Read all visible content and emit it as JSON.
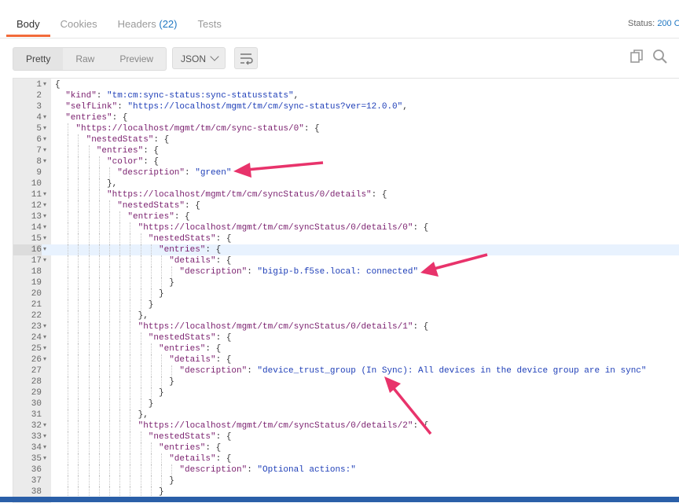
{
  "tabs": {
    "body": "Body",
    "cookies": "Cookies",
    "headers": "Headers",
    "headers_count": "(22)",
    "tests": "Tests"
  },
  "status": {
    "label": "Status:",
    "value": "200 O"
  },
  "toolbar": {
    "pretty": "Pretty",
    "raw": "Raw",
    "preview": "Preview",
    "format": "JSON",
    "icons": [
      "wrap-lines-icon",
      "copy-icon",
      "search-icon"
    ]
  },
  "editor": {
    "highlighted_line": 16,
    "lines": [
      {
        "n": "1",
        "i": 0,
        "f": true,
        "t": [
          [
            "p",
            "{"
          ]
        ]
      },
      {
        "n": "2",
        "i": 1,
        "f": false,
        "t": [
          [
            "k",
            "\"kind\""
          ],
          [
            "p",
            ": "
          ],
          [
            "s",
            "\"tm:cm:sync-status:sync-statusstats\""
          ],
          [
            "p",
            ","
          ]
        ]
      },
      {
        "n": "3",
        "i": 1,
        "f": false,
        "t": [
          [
            "k",
            "\"selfLink\""
          ],
          [
            "p",
            ": "
          ],
          [
            "s",
            "\"https://localhost/mgmt/tm/cm/sync-status?ver=12.0.0\""
          ],
          [
            "p",
            ","
          ]
        ]
      },
      {
        "n": "4",
        "i": 1,
        "f": true,
        "t": [
          [
            "k",
            "\"entries\""
          ],
          [
            "p",
            ": {"
          ]
        ]
      },
      {
        "n": "5",
        "i": 2,
        "f": true,
        "t": [
          [
            "k",
            "\"https://localhost/mgmt/tm/cm/sync-status/0\""
          ],
          [
            "p",
            ": {"
          ]
        ]
      },
      {
        "n": "6",
        "i": 3,
        "f": true,
        "t": [
          [
            "k",
            "\"nestedStats\""
          ],
          [
            "p",
            ": {"
          ]
        ]
      },
      {
        "n": "7",
        "i": 4,
        "f": true,
        "t": [
          [
            "k",
            "\"entries\""
          ],
          [
            "p",
            ": {"
          ]
        ]
      },
      {
        "n": "8",
        "i": 5,
        "f": true,
        "t": [
          [
            "k",
            "\"color\""
          ],
          [
            "p",
            ": {"
          ]
        ]
      },
      {
        "n": "9",
        "i": 6,
        "f": false,
        "t": [
          [
            "k",
            "\"description\""
          ],
          [
            "p",
            ": "
          ],
          [
            "s",
            "\"green\""
          ]
        ]
      },
      {
        "n": "10",
        "i": 5,
        "f": false,
        "t": [
          [
            "p",
            "},"
          ]
        ]
      },
      {
        "n": "11",
        "i": 5,
        "f": true,
        "t": [
          [
            "k",
            "\"https://localhost/mgmt/tm/cm/syncStatus/0/details\""
          ],
          [
            "p",
            ": {"
          ]
        ]
      },
      {
        "n": "12",
        "i": 6,
        "f": true,
        "t": [
          [
            "k",
            "\"nestedStats\""
          ],
          [
            "p",
            ": {"
          ]
        ]
      },
      {
        "n": "13",
        "i": 7,
        "f": true,
        "t": [
          [
            "k",
            "\"entries\""
          ],
          [
            "p",
            ": {"
          ]
        ]
      },
      {
        "n": "14",
        "i": 8,
        "f": true,
        "t": [
          [
            "k",
            "\"https://localhost/mgmt/tm/cm/syncStatus/0/details/0\""
          ],
          [
            "p",
            ": {"
          ]
        ]
      },
      {
        "n": "15",
        "i": 9,
        "f": true,
        "t": [
          [
            "k",
            "\"nestedStats\""
          ],
          [
            "p",
            ": {"
          ]
        ]
      },
      {
        "n": "16",
        "i": 10,
        "f": true,
        "t": [
          [
            "k",
            "\"entries\""
          ],
          [
            "p",
            ": {"
          ]
        ]
      },
      {
        "n": "17",
        "i": 11,
        "f": true,
        "t": [
          [
            "k",
            "\"details\""
          ],
          [
            "p",
            ": {"
          ]
        ]
      },
      {
        "n": "18",
        "i": 12,
        "f": false,
        "t": [
          [
            "k",
            "\"description\""
          ],
          [
            "p",
            ": "
          ],
          [
            "s",
            "\"bigip-b.f5se.local: connected\""
          ]
        ]
      },
      {
        "n": "19",
        "i": 11,
        "f": false,
        "t": [
          [
            "p",
            "}"
          ]
        ]
      },
      {
        "n": "20",
        "i": 10,
        "f": false,
        "t": [
          [
            "p",
            "}"
          ]
        ]
      },
      {
        "n": "21",
        "i": 9,
        "f": false,
        "t": [
          [
            "p",
            "}"
          ]
        ]
      },
      {
        "n": "22",
        "i": 8,
        "f": false,
        "t": [
          [
            "p",
            "},"
          ]
        ]
      },
      {
        "n": "23",
        "i": 8,
        "f": true,
        "t": [
          [
            "k",
            "\"https://localhost/mgmt/tm/cm/syncStatus/0/details/1\""
          ],
          [
            "p",
            ": {"
          ]
        ]
      },
      {
        "n": "24",
        "i": 9,
        "f": true,
        "t": [
          [
            "k",
            "\"nestedStats\""
          ],
          [
            "p",
            ": {"
          ]
        ]
      },
      {
        "n": "25",
        "i": 10,
        "f": true,
        "t": [
          [
            "k",
            "\"entries\""
          ],
          [
            "p",
            ": {"
          ]
        ]
      },
      {
        "n": "26",
        "i": 11,
        "f": true,
        "t": [
          [
            "k",
            "\"details\""
          ],
          [
            "p",
            ": {"
          ]
        ]
      },
      {
        "n": "27",
        "i": 12,
        "f": false,
        "t": [
          [
            "k",
            "\"description\""
          ],
          [
            "p",
            ": "
          ],
          [
            "s",
            "\"device_trust_group (In Sync): All devices in the device group are in sync\""
          ]
        ]
      },
      {
        "n": "28",
        "i": 11,
        "f": false,
        "t": [
          [
            "p",
            "}"
          ]
        ]
      },
      {
        "n": "29",
        "i": 10,
        "f": false,
        "t": [
          [
            "p",
            "}"
          ]
        ]
      },
      {
        "n": "30",
        "i": 9,
        "f": false,
        "t": [
          [
            "p",
            "}"
          ]
        ]
      },
      {
        "n": "31",
        "i": 8,
        "f": false,
        "t": [
          [
            "p",
            "},"
          ]
        ]
      },
      {
        "n": "32",
        "i": 8,
        "f": true,
        "t": [
          [
            "k",
            "\"https://localhost/mgmt/tm/cm/syncStatus/0/details/2\""
          ],
          [
            "p",
            ": {"
          ]
        ]
      },
      {
        "n": "33",
        "i": 9,
        "f": true,
        "t": [
          [
            "k",
            "\"nestedStats\""
          ],
          [
            "p",
            ": {"
          ]
        ]
      },
      {
        "n": "34",
        "i": 10,
        "f": true,
        "t": [
          [
            "k",
            "\"entries\""
          ],
          [
            "p",
            ": {"
          ]
        ]
      },
      {
        "n": "35",
        "i": 11,
        "f": true,
        "t": [
          [
            "k",
            "\"details\""
          ],
          [
            "p",
            ": {"
          ]
        ]
      },
      {
        "n": "36",
        "i": 12,
        "f": false,
        "t": [
          [
            "k",
            "\"description\""
          ],
          [
            "p",
            ": "
          ],
          [
            "s",
            "\"Optional actions:\""
          ]
        ]
      },
      {
        "n": "37",
        "i": 11,
        "f": false,
        "t": [
          [
            "p",
            "}"
          ]
        ]
      },
      {
        "n": "38",
        "i": 10,
        "f": false,
        "t": [
          [
            "p",
            "}"
          ]
        ]
      }
    ]
  },
  "colors": {
    "accent": "#f26b3a",
    "link_blue": "#1f77c2",
    "json_key": "#7a1f6e",
    "json_string": "#1f3fb8",
    "annotation_arrow": "#e8336b",
    "line_highlight": "#e8f2fe"
  }
}
